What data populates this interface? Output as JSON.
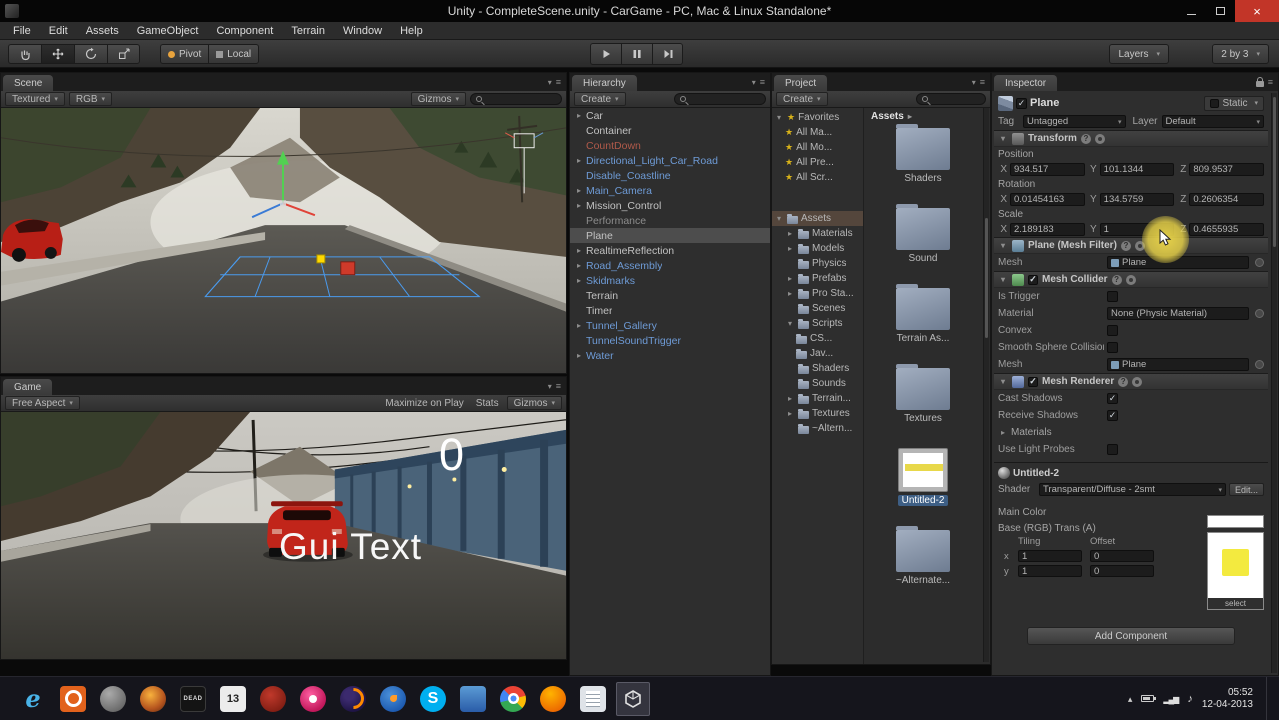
{
  "window": {
    "title": "Unity - CompleteScene.unity - CarGame - PC, Mac & Linux Standalone*"
  },
  "menubar": {
    "items": [
      "File",
      "Edit",
      "Assets",
      "GameObject",
      "Component",
      "Terrain",
      "Window",
      "Help"
    ]
  },
  "toolbar": {
    "pivot_label": "Pivot",
    "local_label": "Local",
    "layers_label": "Layers",
    "layout_label": "2 by 3"
  },
  "scene": {
    "tab": "Scene",
    "draw_mode": "Textured",
    "rgb_label": "RGB",
    "gizmos_label": "Gizmos"
  },
  "game": {
    "tab": "Game",
    "aspect_label": "Free Aspect",
    "maximize_on_play_label": "Maximize on Play",
    "stats_label": "Stats",
    "gizmos_label": "Gizmos",
    "counter_text": "0",
    "gui_text": "Gui Text"
  },
  "hierarchy": {
    "tab": "Hierarchy",
    "create_label": "Create",
    "selected": "Plane",
    "items": [
      {
        "label": "Car"
      },
      {
        "label": "Container"
      },
      {
        "label": "CountDown"
      },
      {
        "label": "Directional_Light_Car_Road"
      },
      {
        "label": "Disable_Coastline"
      },
      {
        "label": "Main_Camera"
      },
      {
        "label": "Mission_Control"
      },
      {
        "label": "Performance"
      },
      {
        "label": "Plane"
      },
      {
        "label": "RealtimeReflection"
      },
      {
        "label": "Road_Assembly"
      },
      {
        "label": "Skidmarks"
      },
      {
        "label": "Terrain"
      },
      {
        "label": "Timer"
      },
      {
        "label": "Tunnel_Gallery"
      },
      {
        "label": "TunnelSoundTrigger"
      },
      {
        "label": "Water"
      }
    ]
  },
  "project": {
    "tab": "Project",
    "create_label": "Create",
    "favorites_label": "Favorites",
    "favorites": [
      {
        "label": "All Ma..."
      },
      {
        "label": "All Mo..."
      },
      {
        "label": "All Pre..."
      },
      {
        "label": "All Scr..."
      }
    ],
    "root_label": "Assets",
    "breadcrumb": "Assets",
    "tree": [
      {
        "label": "Materials"
      },
      {
        "label": "Models"
      },
      {
        "label": "Physics"
      },
      {
        "label": "Prefabs"
      },
      {
        "label": "Pro Sta..."
      },
      {
        "label": "Scenes"
      },
      {
        "label": "Scripts"
      },
      {
        "label": "CS..."
      },
      {
        "label": "Jav..."
      },
      {
        "label": "Shaders"
      },
      {
        "label": "Sounds"
      },
      {
        "label": "Terrain..."
      },
      {
        "label": "Textures"
      },
      {
        "label": "~Altern..."
      }
    ],
    "items": [
      {
        "label": "Shaders"
      },
      {
        "label": "Sound"
      },
      {
        "label": "Terrain As..."
      },
      {
        "label": "Textures"
      },
      {
        "label": "Untitled-2"
      },
      {
        "label": "~Alternate..."
      }
    ],
    "selected_item": "Untitled-2"
  },
  "inspector": {
    "tab": "Inspector",
    "object": {
      "name": "Plane",
      "static_label": "Static",
      "tag_label": "Tag",
      "tag_value": "Untagged",
      "layer_label": "Layer",
      "layer_value": "Default"
    },
    "axis_labels": {
      "x": "X",
      "y": "Y",
      "z": "Z"
    },
    "transform": {
      "title": "Transform",
      "position_label": "Position",
      "rotation_label": "Rotation",
      "scale_label": "Scale",
      "position": {
        "x": "934.517",
        "y": "101.1344",
        "z": "809.9537"
      },
      "rotation": {
        "x": "0.01454163",
        "y": "134.5759",
        "z": "0.2606354"
      },
      "scale": {
        "x": "2.189183",
        "y": "1",
        "z": "0.4655935"
      }
    },
    "mesh_filter": {
      "title": "Plane (Mesh Filter)",
      "mesh_label": "Mesh",
      "mesh_value": "Plane"
    },
    "mesh_collider": {
      "title": "Mesh Collider",
      "is_trigger_label": "Is Trigger",
      "material_label": "Material",
      "material_value": "None (Physic Material)",
      "convex_label": "Convex",
      "smooth_label": "Smooth Sphere Collision",
      "mesh_label": "Mesh",
      "mesh_value": "Plane"
    },
    "mesh_renderer": {
      "title": "Mesh Renderer",
      "cast_shadows_label": "Cast Shadows",
      "receive_shadows_label": "Receive Shadows",
      "materials_label": "Materials",
      "light_probes_label": "Use Light Probes"
    },
    "material": {
      "name": "Untitled-2",
      "shader_label": "Shader",
      "shader_value": "Transparent/Diffuse - 2smt",
      "edit_label": "Edit...",
      "main_color_label": "Main Color",
      "base_label": "Base (RGB) Trans (A)",
      "tiling_label": "Tiling",
      "offset_label": "Offset",
      "x_label": "x",
      "y_label": "y",
      "tiling_x": "1",
      "tiling_y": "1",
      "offset_x": "0",
      "offset_y": "0",
      "select_label": "select"
    },
    "add_component_label": "Add Component"
  },
  "taskbar": {
    "icons": [
      {
        "name": "internet-explorer",
        "glyph": "e"
      },
      {
        "name": "app-orange-ring",
        "glyph": ""
      },
      {
        "name": "app-gray",
        "glyph": ""
      },
      {
        "name": "app-ember",
        "glyph": ""
      },
      {
        "name": "app-dead",
        "glyph": "DEAD"
      },
      {
        "name": "app-13",
        "glyph": "13"
      },
      {
        "name": "app-dark-red",
        "glyph": ""
      },
      {
        "name": "app-magenta",
        "glyph": ""
      },
      {
        "name": "firefox",
        "glyph": ""
      },
      {
        "name": "thunderbird",
        "glyph": ""
      },
      {
        "name": "skype",
        "glyph": "S"
      },
      {
        "name": "app-blue",
        "glyph": ""
      },
      {
        "name": "chrome",
        "glyph": ""
      },
      {
        "name": "app-amber",
        "glyph": ""
      },
      {
        "name": "notes",
        "glyph": ""
      },
      {
        "name": "unity",
        "glyph": ""
      }
    ],
    "clock_time": "05:52",
    "clock_date": "12-04-2013"
  },
  "colors": {
    "prefab_text_blue": "#6e9bd6",
    "broken_text_red": "#b05a4a",
    "selection_gray": "#4d4d4d",
    "close_button_red": "#c23528",
    "highlight_yellow": "#eed84a",
    "skype_blue": "#00aff0",
    "folder_blue_gray": "#8a97aa",
    "favorite_star_yellow": "#d8b21a",
    "texture_yellow": "#f3ea3f"
  }
}
